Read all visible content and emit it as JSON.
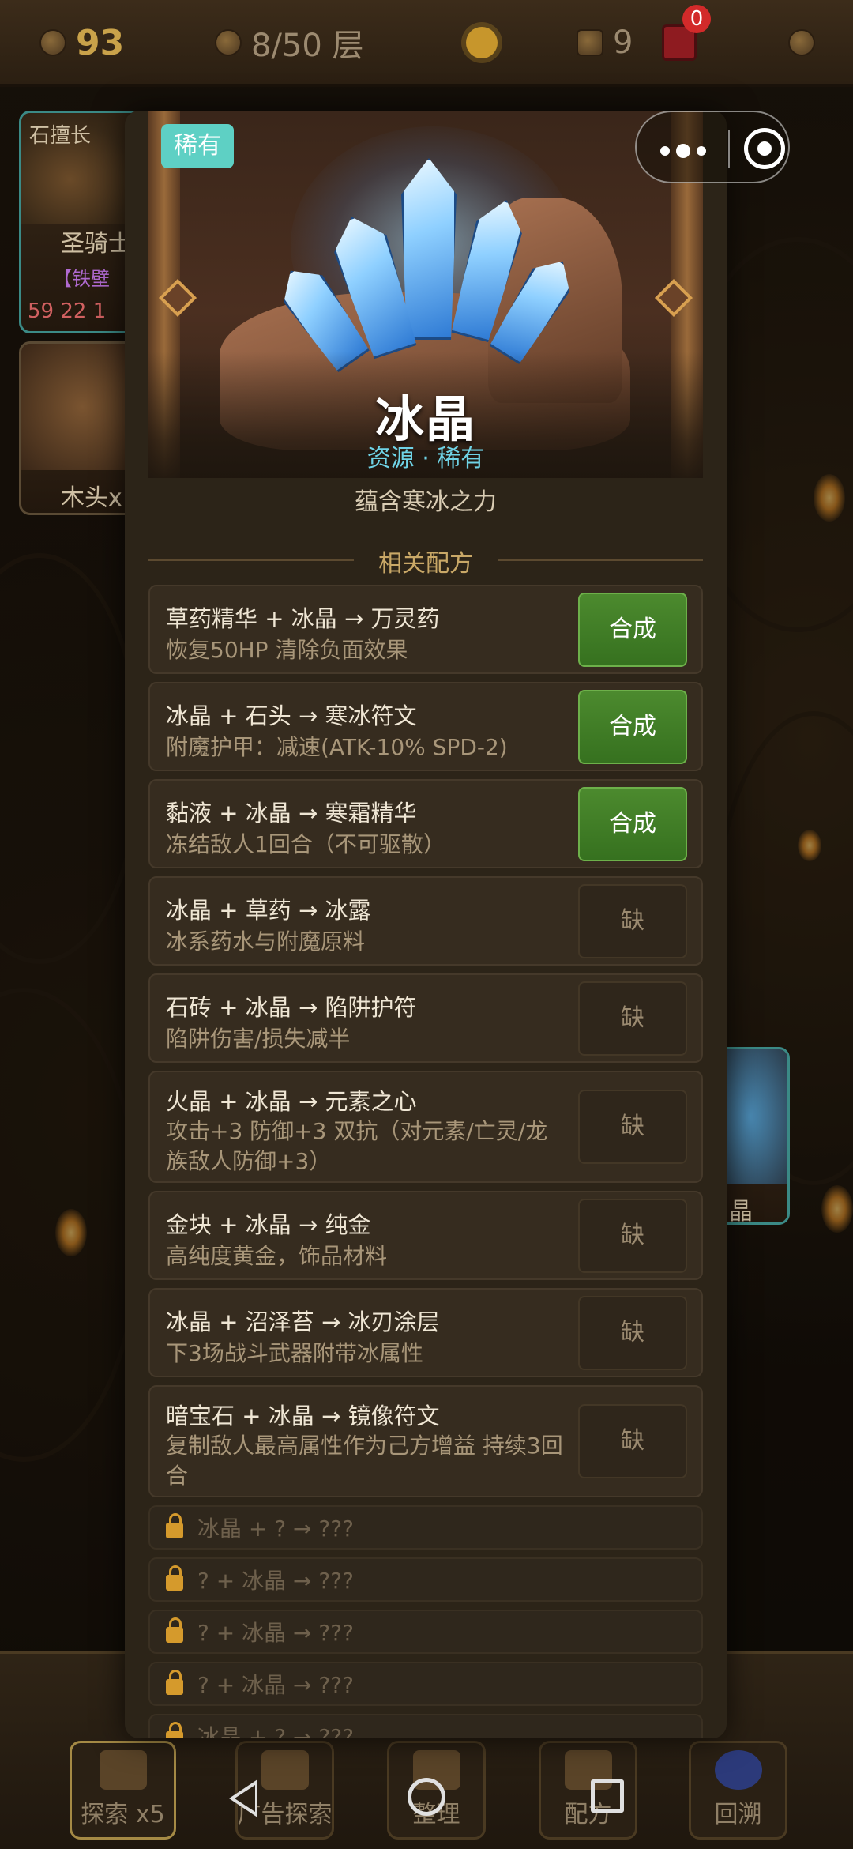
{
  "topbar": {
    "gold": "93",
    "floor": "8/50 层",
    "cards": "9",
    "chest_badge": "0"
  },
  "background": {
    "card1": {
      "tag": "石擅长",
      "name": "圣骑士",
      "sub": "【铁壁",
      "stats": "59 22 1"
    },
    "card2": {
      "name": "木头x"
    },
    "card3": {
      "name": "晶"
    }
  },
  "modal": {
    "rarity_badge": "稀有",
    "item_name": "冰晶",
    "item_subtitle": "资源 · 稀有",
    "item_description": "蕴含寒冰之力",
    "section_title": "相关配方",
    "recipes": [
      {
        "formula": "草药精华 + 冰晶 → 万灵药",
        "effect": "恢复50HP 清除负面效果",
        "action": "合成",
        "available": true
      },
      {
        "formula": "冰晶 + 石头 → 寒冰符文",
        "effect": "附魔护甲：减速(ATK-10% SPD-2)",
        "action": "合成",
        "available": true
      },
      {
        "formula": "黏液 + 冰晶 → 寒霜精华",
        "effect": "冻结敌人1回合（不可驱散）",
        "action": "合成",
        "available": true
      },
      {
        "formula": "冰晶 + 草药 → 冰露",
        "effect": "冰系药水与附魔原料",
        "action": "缺",
        "available": false
      },
      {
        "formula": "石砖 + 冰晶 → 陷阱护符",
        "effect": "陷阱伤害/损失减半",
        "action": "缺",
        "available": false
      },
      {
        "formula": "火晶 + 冰晶 → 元素之心",
        "effect": "攻击+3 防御+3 双抗（对元素/亡灵/龙族敌人防御+3）",
        "action": "缺",
        "available": false
      },
      {
        "formula": "金块 + 冰晶 → 纯金",
        "effect": "高纯度黄金，饰品材料",
        "action": "缺",
        "available": false
      },
      {
        "formula": "冰晶 + 沼泽苔 → 冰刃涂层",
        "effect": "下3场战斗武器附带冰属性",
        "action": "缺",
        "available": false
      },
      {
        "formula": "暗宝石 + 冰晶 → 镜像符文",
        "effect": "复制敌人最高属性作为己方增益 持续3回合",
        "action": "缺",
        "available": false
      }
    ],
    "locked_recipes": [
      "冰晶 + ? → ???",
      "? + 冰晶 → ???",
      "? + 冰晶 → ???",
      "? + 冰晶 → ???",
      "冰晶 + ? → ???"
    ]
  },
  "bottom_nav": [
    {
      "label": "探索 x5"
    },
    {
      "label": "广告探索"
    },
    {
      "label": "整理"
    },
    {
      "label": "配方"
    },
    {
      "label": "回溯"
    }
  ]
}
